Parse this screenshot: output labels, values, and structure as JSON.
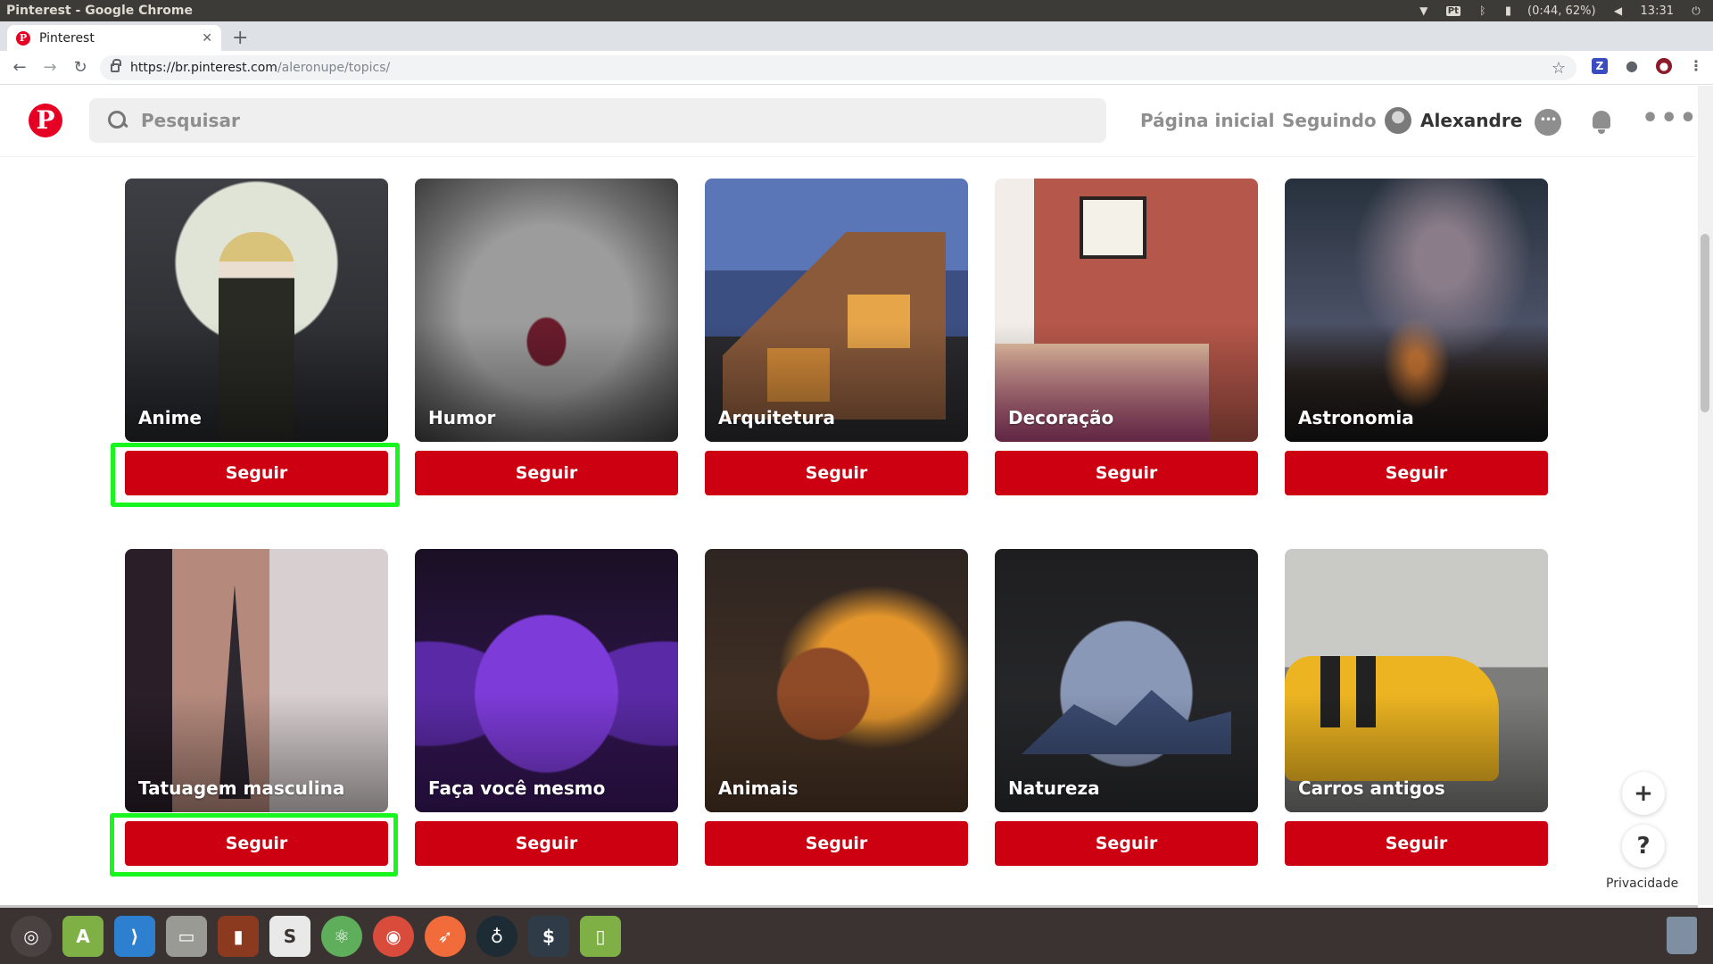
{
  "os": {
    "window_title": "Pinterest - Google Chrome",
    "battery": "(0:44, 62%)",
    "time": "13:31",
    "lang_badge": "Pt"
  },
  "browser": {
    "tab_title": "Pinterest",
    "url_host": "https://br.pinterest.com",
    "url_path": "/aleronupe/topics/"
  },
  "header": {
    "search_placeholder": "Pesquisar",
    "nav_home": "Página inicial",
    "nav_following": "Seguindo",
    "user_name": "Alexandre"
  },
  "topics": [
    {
      "name": "Anime",
      "button": "Seguir"
    },
    {
      "name": "Humor",
      "button": "Seguir"
    },
    {
      "name": "Arquitetura",
      "button": "Seguir"
    },
    {
      "name": "Decoração",
      "button": "Seguir"
    },
    {
      "name": "Astronomia",
      "button": "Seguir"
    },
    {
      "name": "Tatuagem masculina",
      "button": "Seguir"
    },
    {
      "name": "Faça você mesmo",
      "button": "Seguir"
    },
    {
      "name": "Animais",
      "button": "Seguir"
    },
    {
      "name": "Natureza",
      "button": "Seguir"
    },
    {
      "name": "Carros antigos",
      "button": "Seguir"
    }
  ],
  "float": {
    "add": "+",
    "help": "?",
    "privacy": "Privacidade"
  },
  "colors": {
    "brand": "#e60023",
    "follow_button": "#cc0011",
    "highlight": "#19f51f"
  },
  "dock": {
    "apps": [
      "ubuntu-icon",
      "android-studio-icon",
      "vscode-icon",
      "files-icon",
      "book-icon",
      "slack-icon",
      "atom-icon",
      "chrome-icon",
      "postman-icon",
      "gitkraken-icon",
      "terminal-icon",
      "tablet-icon"
    ]
  }
}
